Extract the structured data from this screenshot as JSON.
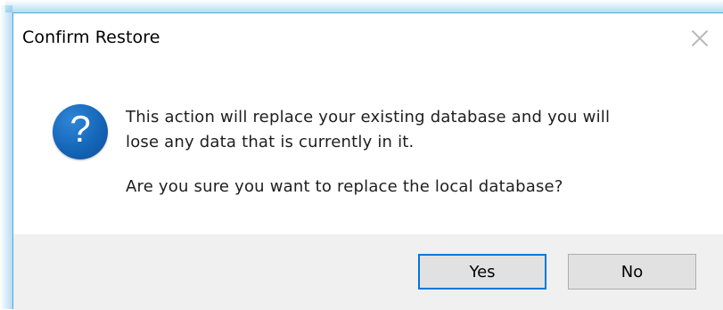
{
  "dialog": {
    "title": "Confirm Restore",
    "icon": "question-icon",
    "icon_glyph": "?",
    "message_line1": "This action will replace your existing database and you will",
    "message_line2": "lose any data that is currently in it.",
    "message_question": "Are you sure you want to replace the local database?",
    "buttons": {
      "yes_label": "Yes",
      "no_label": "No"
    },
    "default_button": "Yes",
    "accent_color": "#0078d7",
    "icon_color": "#1566b8"
  }
}
